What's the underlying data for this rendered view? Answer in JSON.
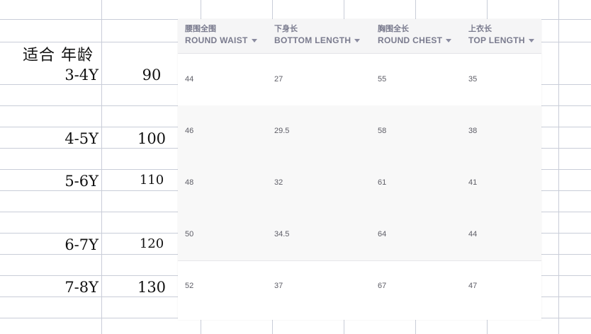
{
  "sheet": {
    "header_label": "适合 年龄",
    "rows": [
      {
        "age": "3-4Y",
        "height": "90"
      },
      {
        "age": "4-5Y",
        "height": "100"
      },
      {
        "age": "5-6Y",
        "height": "110"
      },
      {
        "age": "6-7Y",
        "height": "120"
      },
      {
        "age": "7-8Y",
        "height": "130"
      }
    ]
  },
  "size_table": {
    "columns": [
      {
        "zh": "腰围全围",
        "en": "ROUND WAIST"
      },
      {
        "zh": "下身长",
        "en": "BOTTOM LENGTH"
      },
      {
        "zh": "胸围全长",
        "en": "ROUND CHEST"
      },
      {
        "zh": "上衣长",
        "en": "TOP LENGTH"
      }
    ],
    "rows": [
      [
        "44",
        "27",
        "55",
        "35"
      ],
      [
        "46",
        "29.5",
        "58",
        "38"
      ],
      [
        "48",
        "32",
        "61",
        "41"
      ],
      [
        "50",
        "34.5",
        "64",
        "44"
      ],
      [
        "52",
        "37",
        "67",
        "47"
      ]
    ]
  }
}
